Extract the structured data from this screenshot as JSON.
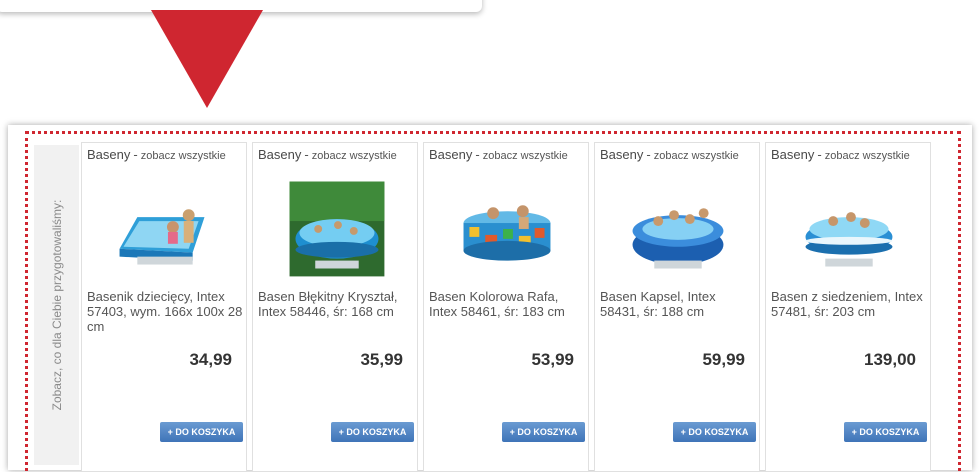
{
  "colors": {
    "accent_red": "#cf2630",
    "button_blue": "#4a7fc1"
  },
  "sidebar": {
    "label": "Zobacz, co dla Ciebie przygotowaliśmy:"
  },
  "products": [
    {
      "category": "Baseny",
      "see_all": "zobacz wszystkie",
      "name": "Basenik dziecięcy, Intex 57403, wym. 166x 100x 28 cm",
      "price": "34,99",
      "button": "+ DO KOSZYKA",
      "image": "rectangular-pool-image"
    },
    {
      "category": "Baseny",
      "see_all": "zobacz wszystkie",
      "name": "Basen Błękitny Kryształ, Intex 58446, śr: 168 cm",
      "price": "35,99",
      "button": "+ DO KOSZYKA",
      "image": "round-pool-on-grass-image"
    },
    {
      "category": "Baseny",
      "see_all": "zobacz wszystkie",
      "name": "Basen Kolorowa Rafa, Intex 58461, śr: 183 cm",
      "price": "53,99",
      "button": "+ DO KOSZYKA",
      "image": "reef-pattern-pool-image"
    },
    {
      "category": "Baseny",
      "see_all": "zobacz wszystkie",
      "name": "Basen Kapsel, Intex 58431, śr: 188 cm",
      "price": "59,99",
      "button": "+ DO KOSZYKA",
      "image": "bottle-cap-pool-image"
    },
    {
      "category": "Baseny",
      "see_all": "zobacz wszystkie",
      "name": "Basen z siedzeniem, Intex 57481, śr: 203 cm",
      "price": "139,00",
      "button": "+ DO KOSZYKA",
      "image": "pool-with-seat-image"
    }
  ]
}
